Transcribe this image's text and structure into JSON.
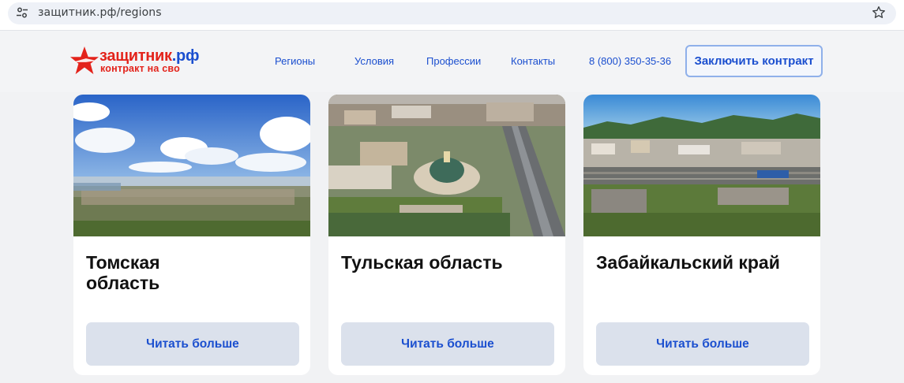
{
  "browser": {
    "url": "защитник.рф/regions"
  },
  "header": {
    "logo_name": "защитник",
    "logo_tld": ".рф",
    "logo_sub": "контракт на сво",
    "nav": [
      {
        "label": "Регионы"
      },
      {
        "label": "Условия"
      },
      {
        "label": "Профессии"
      },
      {
        "label": "Контакты"
      }
    ],
    "phone": "8 (800) 350-35-36",
    "cta_label": "Заключить контракт"
  },
  "colors": {
    "brand_red": "#e3231b",
    "brand_blue": "#1b4fcf",
    "button_bg": "#dbe1ec"
  },
  "regions": [
    {
      "title": "Томская область",
      "button": "Читать больше"
    },
    {
      "title": "Тульская область",
      "button": "Читать больше"
    },
    {
      "title": "Забайкальский край",
      "button": "Читать больше"
    }
  ],
  "icons": {
    "site_info": "tune-icon",
    "bookmark": "star-icon",
    "logo": "red-star-icon"
  }
}
